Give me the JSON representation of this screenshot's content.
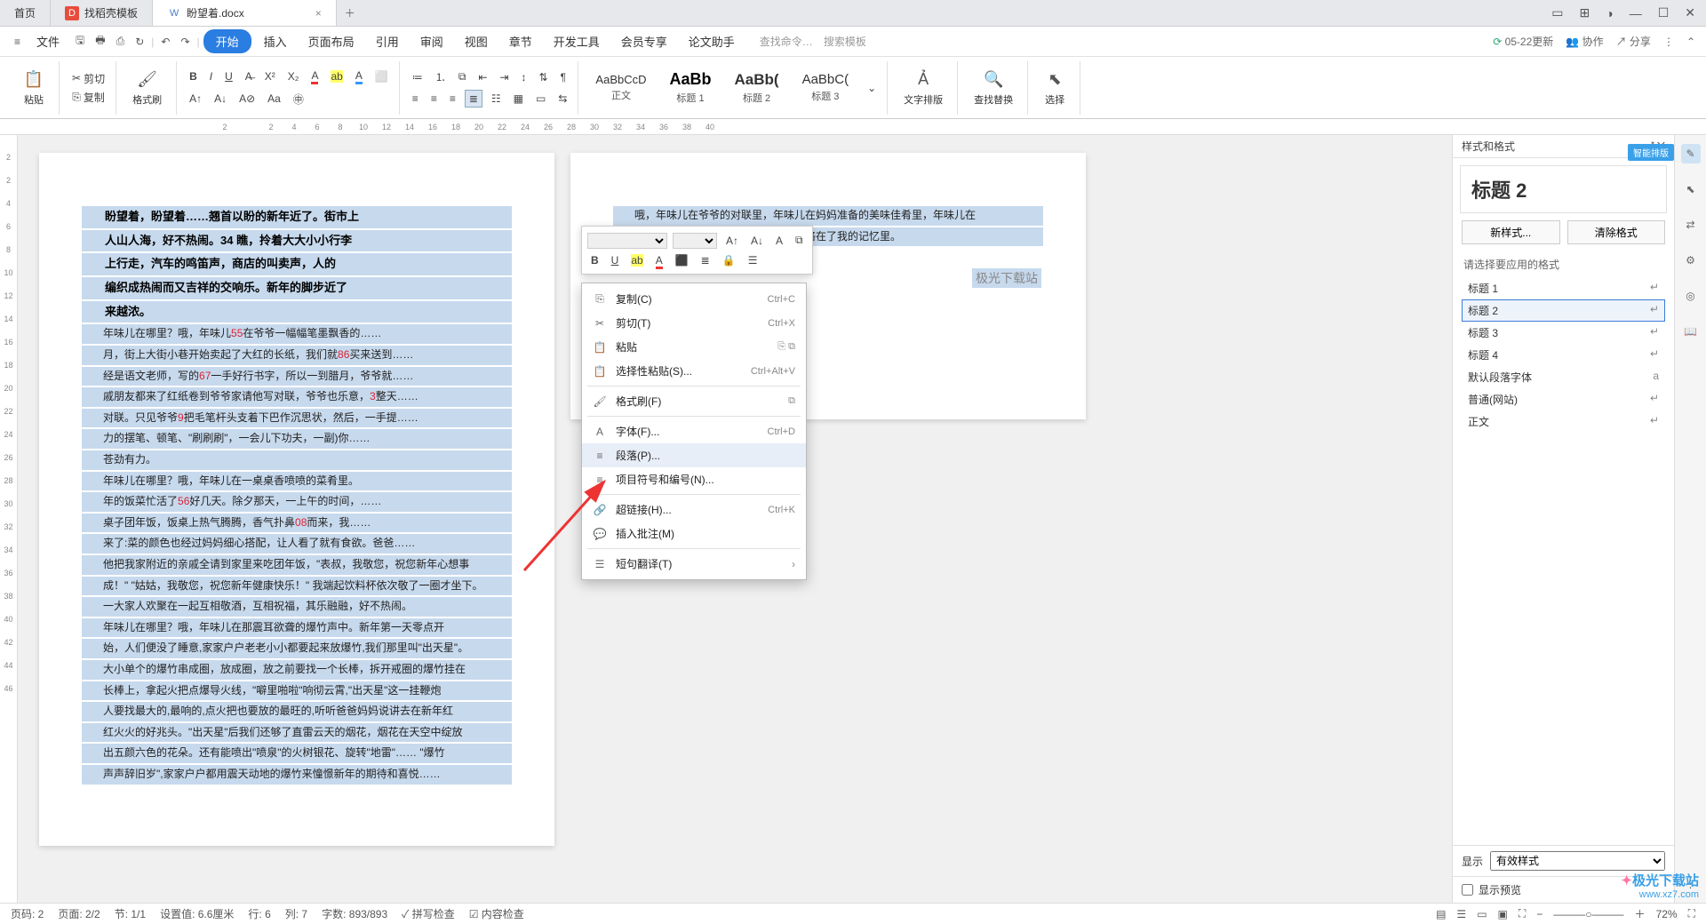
{
  "titlebar": {
    "tabs": [
      {
        "label": "首页",
        "icon": ""
      },
      {
        "label": "找稻壳模板",
        "icon": "D"
      },
      {
        "label": "盼望着.docx",
        "icon": "W"
      }
    ],
    "add": "＋",
    "win": {
      "layout": "▭",
      "grid": "⊞",
      "avatar": "◑",
      "min": "—",
      "max": "☐",
      "close": "✕"
    }
  },
  "menubar": {
    "hamburger": "≡",
    "file": "文件",
    "quick_icons": [
      "🖶",
      "⎙",
      "⇆",
      "⟲",
      "↶",
      "↷"
    ],
    "items": [
      "开始",
      "插入",
      "页面布局",
      "引用",
      "审阅",
      "视图",
      "章节",
      "开发工具",
      "会员专享",
      "论文助手"
    ],
    "search_placeholder": "查找命令…",
    "template_placeholder": "搜索模板",
    "right": {
      "update": "05-22更新",
      "coop": "协作",
      "share": "分享"
    }
  },
  "ribbon": {
    "paste": "粘贴",
    "cut": "剪切",
    "copy": "复制",
    "painter": "格式刷",
    "bold": "B",
    "italic": "I",
    "underline": "U",
    "styles": [
      {
        "preview": "AaBbCcD",
        "name": "正文"
      },
      {
        "preview": "AaBb",
        "name": "标题 1"
      },
      {
        "preview": "AaBb(",
        "name": "标题 2"
      },
      {
        "preview": "AaBbC(",
        "name": "标题 3"
      }
    ],
    "text_layout": "文字排版",
    "find_replace": "查找替换",
    "select": "选择"
  },
  "ruler": {
    "ticks": [
      "2",
      "",
      "2",
      "4",
      "6",
      "8",
      "10",
      "12",
      "14",
      "16",
      "18",
      "20",
      "22",
      "24",
      "26",
      "28",
      "30",
      "32",
      "34",
      "36",
      "38",
      "40"
    ]
  },
  "vruler": {
    "ticks": [
      "2",
      "",
      "2",
      "4",
      "6",
      "8",
      "10",
      "12",
      "14",
      "16",
      "18",
      "20",
      "22",
      "24",
      "26",
      "28",
      "30",
      "32",
      "34",
      "36",
      "38",
      "40",
      "42",
      "44",
      "46"
    ]
  },
  "document": {
    "bold_lines": [
      "盼望着，盼望着……翘首以盼的新年近了。街市上",
      "人山人海，好不热闹。34 瞧，拎着大大小小行李",
      "上行走，汽车的鸣笛声，商店的叫卖声，人的",
      "编织成热闹而又吉祥的交响乐。新年的脚步近了",
      "来越浓。"
    ],
    "para2_a": "年味儿在哪里？哦，年味儿",
    "para2_55": "55",
    "para2_b": "在爷爷一幅幅笔墨飘香的……",
    "para3_a": "月，街上大街小巷开始卖起了大红的长纸，我们就",
    "para3_86": "86",
    "para3_b": "买来送到……",
    "para4_a": "经是语文老师，写的",
    "para4_67": "67",
    "para4_b": "一手好行书字，所以一到腊月，爷爷就……",
    "para5_a": "戚朋友都来了红纸卷到爷爷家请他写对联，爷爷也乐意，",
    "para5_3": "3",
    "para5_b": "整天……",
    "para6_a": "对联。只见爷爷",
    "para6_9": "9",
    "para6_b": "把毛笔杆头支着下巴作沉思状，然后，一手提……",
    "para7": "力的摆笔、顿笔、\"刷刷刷\"，一会儿下功夫，一副)你……",
    "para8": "苍劲有力。",
    "para9": "年味儿在哪里？哦，年味儿在一桌桌香喷喷的菜肴里。",
    "para10_a": "年的饭菜忙活了",
    "para10_56": "56",
    "para10_b": "好几天。除夕那天，一上午的时间，……",
    "para11_a": "桌子团年饭，饭桌上热气腾腾，香气扑鼻",
    "para11_08": "08",
    "para11_b": "而来，我……",
    "para12": "来了:菜的颜色也经过妈妈细心搭配，让人看了就有食欲。爸爸……",
    "para13": "他把我家附近的亲戚全请到家里来吃团年饭，\"表叔，我敬您，祝您新年心想事",
    "para14": "成！\" \"姑姑，我敬您，祝您新年健康快乐！\" 我端起饮料杯依次敬了一圈才坐下。",
    "para15": "一大家人欢聚在一起互相敬酒，互相祝福，其乐融融，好不热闹。",
    "para16": "年味儿在哪里？哦，年味儿在那震耳欲聋的爆竹声中。新年第一天零点开",
    "para17": "始，人们便没了睡意,家家户户老老小小都要起来放爆竹,我们那里叫\"出天星\"。",
    "para18": "大小单个的爆竹串成圈，放成圈，放之前要找一个长棒，拆开戒圈的爆竹挂在",
    "para19": "长棒上，拿起火把点爆导火线，\"噼里啪啦\"响彻云霄,\"出天星\"这一挂鞭炮",
    "para20": "人要找最大的,最响的,点火把也要放的最旺的,听听爸爸妈妈说讲去在新年红",
    "para21": "红火火的好兆头。\"出天星\"后我们还够了直雷云天的烟花，烟花在天空中绽放",
    "para22": "出五颜六色的花朵。还有能喷出\"喷泉\"的火树银花、旋转\"地雷\"…… \"爆竹",
    "para23": "声声辞旧岁\",家家户户都用震天动地的爆竹来憧憬新年的期待和喜悦……",
    "page2_line1": "哦，年味儿在爷爷的对联里，年味儿在妈妈准备的美味佳肴里，年味儿在",
    "page2_line2": "一声声爆竹里……年味儿更是牢牢地烙在了我的记忆里。",
    "watermark": "极光下载站"
  },
  "float_toolbar": {
    "font_dropdown": "",
    "size_dropdown": "",
    "icons": [
      "A↑",
      "A↓",
      "A",
      "⧉",
      "B",
      "A̲",
      "⚡",
      "A",
      "⬛",
      "☰",
      "🔒",
      "☰"
    ]
  },
  "context_menu": {
    "items": [
      {
        "icon": "⎘",
        "label": "复制(C)",
        "short": "Ctrl+C"
      },
      {
        "icon": "✂",
        "label": "剪切(T)",
        "short": "Ctrl+X"
      },
      {
        "icon": "📋",
        "label": "粘贴",
        "short": "",
        "right_icons": true
      },
      {
        "icon": "📋",
        "label": "选择性粘贴(S)...",
        "short": "Ctrl+Alt+V"
      },
      {
        "sep": true
      },
      {
        "icon": "🖌",
        "label": "格式刷(F)",
        "short": "",
        "right_icons": true
      },
      {
        "sep": true
      },
      {
        "icon": "A",
        "label": "字体(F)...",
        "short": "Ctrl+D"
      },
      {
        "icon": "≡",
        "label": "段落(P)...",
        "short": "",
        "hover": true
      },
      {
        "icon": "≡",
        "label": "项目符号和编号(N)...",
        "short": ""
      },
      {
        "sep": true
      },
      {
        "icon": "🔗",
        "label": "超链接(H)...",
        "short": "Ctrl+K"
      },
      {
        "icon": "💬",
        "label": "插入批注(M)",
        "short": ""
      },
      {
        "sep": true
      },
      {
        "icon": "☰",
        "label": "短句翻译(T)",
        "short": "",
        "arrow": true
      }
    ]
  },
  "rpanel": {
    "title": "样式和格式",
    "heading": "标题 2",
    "new_style": "新样式...",
    "clear_fmt": "清除格式",
    "hint": "请选择要应用的格式",
    "styles": [
      "标题 1",
      "标题 2",
      "标题 3",
      "标题 4",
      "默认段落字体",
      "普通(网站)",
      "正文"
    ],
    "active_index": 1,
    "show_label": "显示",
    "show_value": "有效样式",
    "preview_chk": "显示预览"
  },
  "smart_badge": "智能排版",
  "statusbar": {
    "page_total": "页码: 2",
    "page_pos": "页面: 2/2",
    "section": "节: 1/1",
    "setval": "设置值: 6.6厘米",
    "line": "行: 6",
    "col": "列: 7",
    "words": "字数: 893/893",
    "spellcheck": "拼写检查",
    "content_check": "内容检查",
    "zoom": "72%"
  },
  "logo": {
    "line1": "极光下载站",
    "line2": "www.xz7.com"
  }
}
